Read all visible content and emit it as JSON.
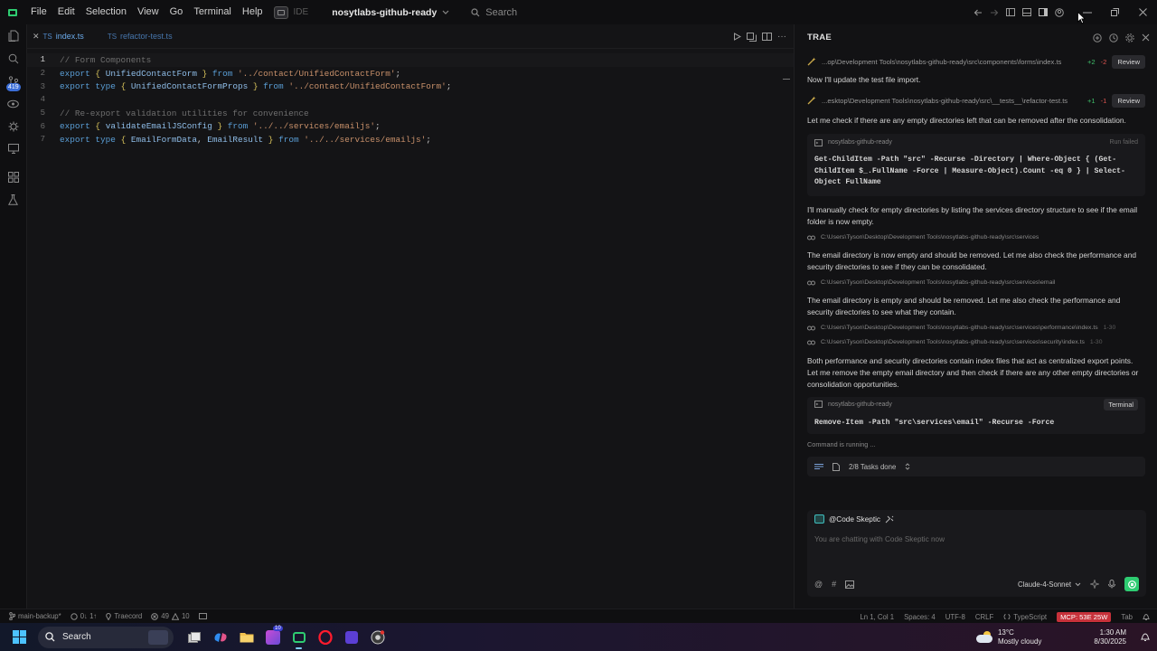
{
  "menu": [
    "File",
    "Edit",
    "Selection",
    "View",
    "Go",
    "Terminal",
    "Help"
  ],
  "ide_label": "IDE",
  "project_name": "nosytlabs-github-ready",
  "search_placeholder": "Search",
  "tabs": [
    {
      "lang": "TS",
      "name": "index.ts",
      "active": true
    },
    {
      "lang": "TS",
      "name": "refactor-test.ts",
      "active": false
    }
  ],
  "code": {
    "line_numbers": [
      "1",
      "2",
      "3",
      "4",
      "5",
      "6",
      "7"
    ],
    "l1": "// Form Components",
    "l2": {
      "kw1": "export",
      "b1": "{",
      "id": "UnifiedContactForm",
      "b2": "}",
      "kw2": "from",
      "str": "'../contact/UnifiedContactForm'",
      "end": ";"
    },
    "l3": {
      "kw1": "export",
      "kw2": "type",
      "b1": "{",
      "id": "UnifiedContactFormProps",
      "b2": "}",
      "kw3": "from",
      "str": "'../contact/UnifiedContactForm'",
      "end": ";"
    },
    "l5": "// Re-export validation utilities for convenience",
    "l6": {
      "kw1": "export",
      "b1": "{",
      "id": "validateEmailJSConfig",
      "b2": "}",
      "kw2": "from",
      "str": "'../../services/emailjs'",
      "end": ";"
    },
    "l7": {
      "kw1": "export",
      "kw2": "type",
      "b1": "{",
      "id1": "EmailFormData",
      "comma": ",",
      "id2": "EmailResult",
      "b2": "}",
      "kw3": "from",
      "str": "'../../services/emailjs'",
      "end": ";"
    }
  },
  "panel": {
    "title": "TRAE",
    "chip1": {
      "path": "...op\\Development Tools\\nosytlabs-github-ready\\src\\components\\forms\\index.ts",
      "add": "+2",
      "del": "-2",
      "btn": "Review"
    },
    "msg1": "Now I'll update the test file import.",
    "chip2": {
      "path": "...esktop\\Development Tools\\nosytlabs-github-ready\\src\\__tests__\\refactor-test.ts",
      "add": "+1",
      "del": "-1",
      "btn": "Review"
    },
    "msg2": "Let me check if there are any empty directories left that can be removed after the consolidation.",
    "cmd1": {
      "project": "nosytlabs-github-ready",
      "status": "Run failed",
      "text": "Get-ChildItem -Path \"src\" -Recurse -Directory | Where-Object { (Get-ChildItem $_.FullName -Force | Measure-Object).Count -eq 0 } | Select-Object FullName"
    },
    "msg3": "I'll manually check for empty directories by listing the services directory structure to see if the email folder is now empty.",
    "dir1": "C:\\Users\\Tyson\\Desktop\\Development Tools\\nosytlabs-github-ready\\src\\services",
    "msg4": "The email directory is now empty and should be removed. Let me also check the performance and security directories to see if they can be consolidated.",
    "dir2": "C:\\Users\\Tyson\\Desktop\\Development Tools\\nosytlabs-github-ready\\src\\services\\email",
    "msg5": "The email directory is empty and should be removed. Let me also check the performance and security directories to see what they contain.",
    "dir3": {
      "path": "C:\\Users\\Tyson\\Desktop\\Development Tools\\nosytlabs-github-ready\\src\\services\\performance\\index.ts",
      "range": "1-30"
    },
    "dir4": {
      "path": "C:\\Users\\Tyson\\Desktop\\Development Tools\\nosytlabs-github-ready\\src\\services\\security\\index.ts",
      "range": "1-30"
    },
    "msg6": "Both performance and security directories contain index files that act as centralized export points. Let me remove the empty email directory and then check if there are any other empty directories or consolidation opportunities.",
    "cmd2": {
      "project": "nosytlabs-github-ready",
      "btn": "Terminal",
      "text": "Remove-Item -Path \"src\\services\\email\" -Recurse -Force"
    },
    "running": "Command is running ...",
    "tasks": "2/8 Tasks done",
    "agent": "@Code Skeptic",
    "chat_placeholder": "You are chatting with Code Skeptic now",
    "model": "Claude-4-Sonnet"
  },
  "status": {
    "branch": "main-backup*",
    "sync": "0↓ 1↑",
    "trae": "Traecord",
    "problems": "49",
    "warnings": "10",
    "position": "Ln 1, Col 1",
    "spaces": "Spaces: 4",
    "encoding": "UTF-8",
    "eol": "CRLF",
    "language": "TypeScript",
    "mcp": "MCP: 53E 25W",
    "tab": "Tab"
  },
  "taskbar": {
    "search": "Search",
    "temp": "13°C",
    "weather": "Mostly cloudy",
    "time": "1:30 AM",
    "date": "8/30/2025",
    "badge_count": "10"
  },
  "activity_badge": "419",
  "colors": {
    "accent_green": "#2ecc71",
    "mcp_red": "#c7313a",
    "link_blue": "#4f86c6"
  }
}
